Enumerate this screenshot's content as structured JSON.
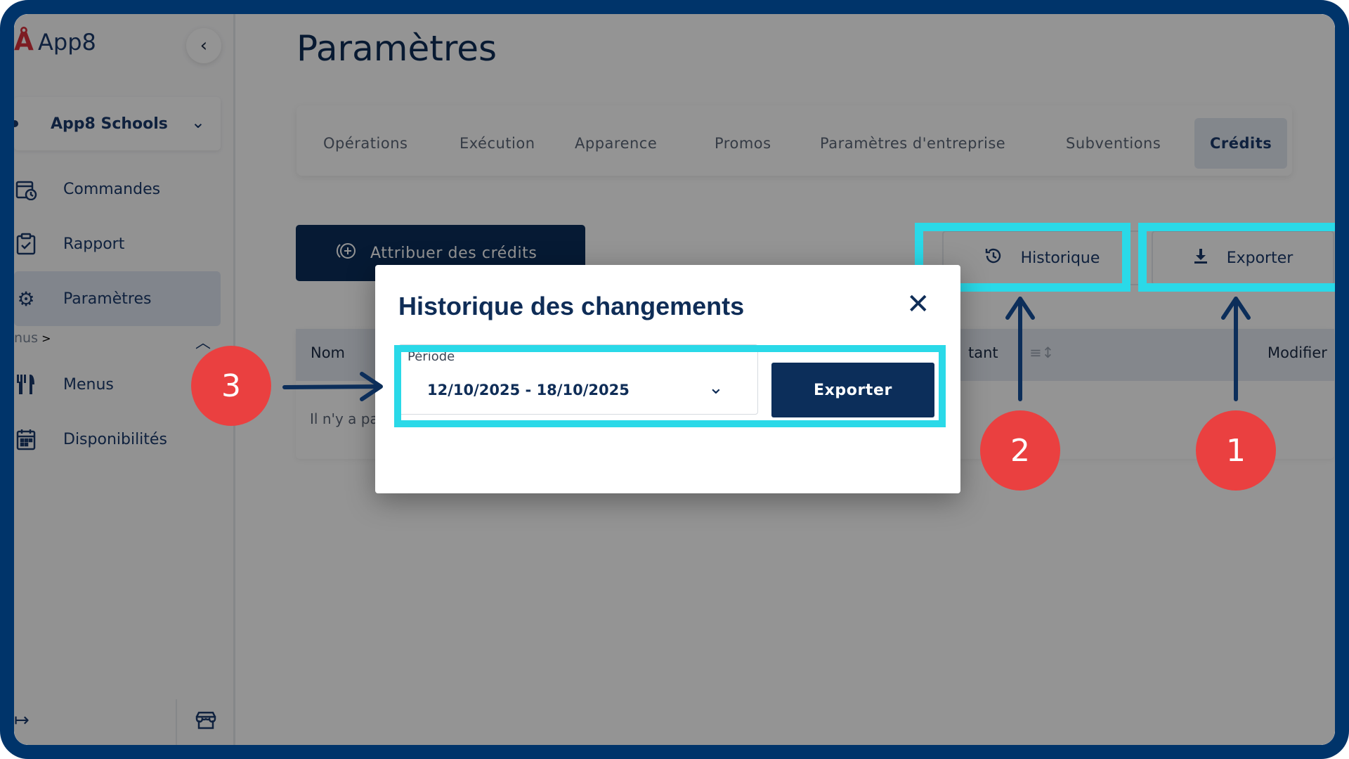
{
  "app": {
    "brand_name": "App8",
    "collapse_icon": "chevron-left-icon"
  },
  "sidebar": {
    "org_select": {
      "label": "App8 Schools"
    },
    "items": [
      {
        "label": "Commandes",
        "icon": "orders-clock-icon"
      },
      {
        "label": "Rapport",
        "icon": "clipboard-check-icon"
      },
      {
        "label": "Paramètres",
        "icon": "gear-icon",
        "active": true
      },
      {
        "label": "Menus",
        "icon": "fork-knife-icon"
      },
      {
        "label": "Disponibilités",
        "icon": "calendar-icon"
      }
    ],
    "section_label": "nus",
    "bottom_left_icon": "logout-icon",
    "bottom_right_icon": "store-icon"
  },
  "page": {
    "title": "Paramètres",
    "tabs": [
      "Opérations",
      "Exécution",
      "Apparence",
      "Promos",
      "Paramètres d'entreprise",
      "Subventions",
      "Crédits"
    ],
    "active_tab": "Crédits"
  },
  "actions": {
    "assign_label": "Attribuer des crédits",
    "history_label": "Historique",
    "export_label": "Exporter"
  },
  "table": {
    "headers": {
      "name": "Nom",
      "amount_partial": "tant",
      "modify": "Modifier"
    },
    "empty_text_partial": "Il n'y a pas"
  },
  "modal": {
    "title": "Historique des changements",
    "period_label": "Période",
    "period_value": "12/10/2025 - 18/10/2025",
    "export_label": "Exporter"
  },
  "annotations": {
    "markers": [
      "1",
      "2",
      "3"
    ],
    "highlight_color": "#2ad9e8",
    "marker_color": "#ea4040",
    "arrow_color": "#0c2e5a"
  }
}
